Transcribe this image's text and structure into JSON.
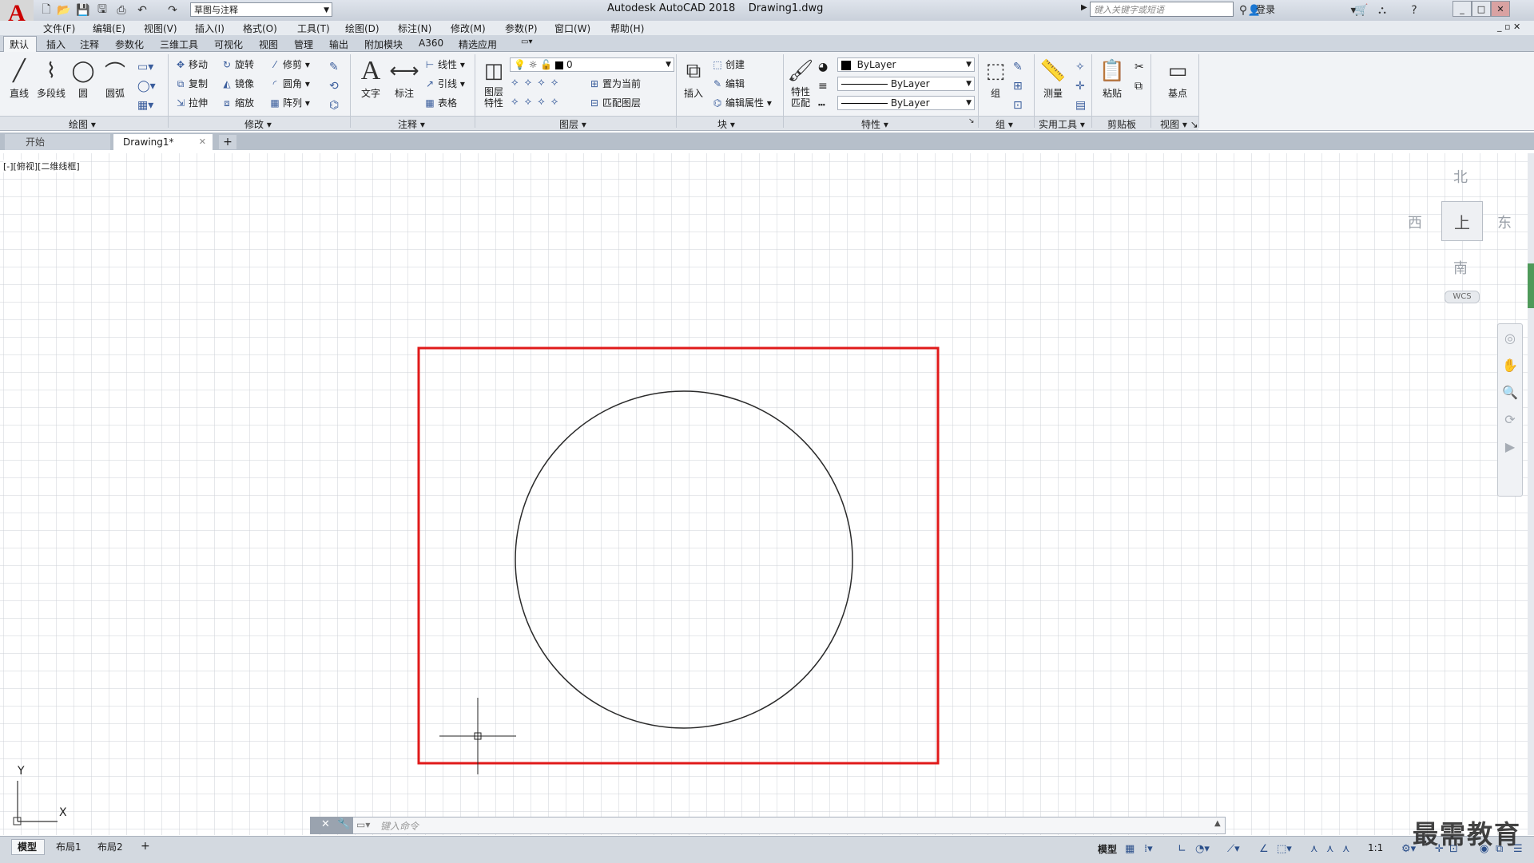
{
  "app": {
    "title": "Autodesk AutoCAD 2018",
    "file": "Drawing1.dwg"
  },
  "quick_access": {
    "workspace": "草图与注释"
  },
  "search": {
    "placeholder": "键入关键字或短语"
  },
  "user": {
    "login": "登录"
  },
  "menus": [
    "文件(F)",
    "编辑(E)",
    "视图(V)",
    "插入(I)",
    "格式(O)",
    "工具(T)",
    "绘图(D)",
    "标注(N)",
    "修改(M)",
    "参数(P)",
    "窗口(W)",
    "帮助(H)"
  ],
  "ribbon_tabs": [
    "默认",
    "插入",
    "注释",
    "参数化",
    "三维工具",
    "可视化",
    "视图",
    "管理",
    "输出",
    "附加模块",
    "A360",
    "精选应用"
  ],
  "ribbon": {
    "draw": {
      "title": "绘图",
      "line": "直线",
      "polyline": "多段线",
      "circle": "圆",
      "arc": "圆弧"
    },
    "modify": {
      "title": "修改",
      "move": "移动",
      "rotate": "旋转",
      "trim": "修剪",
      "copy": "复制",
      "mirror": "镜像",
      "fillet": "圆角",
      "stretch": "拉伸",
      "scale": "缩放",
      "array": "阵列"
    },
    "annotation": {
      "title": "注释",
      "text": "文字",
      "dimension": "标注",
      "linear": "线性",
      "leader": "引线",
      "table": "表格"
    },
    "layers": {
      "title": "图层",
      "properties_line1": "图层",
      "properties_line2": "特性",
      "current_layer": "0",
      "make_current": "置为当前",
      "match_layer": "匹配图层"
    },
    "block": {
      "title": "块",
      "insert": "插入",
      "create": "创建",
      "edit": "编辑",
      "edit_attributes": "编辑属性"
    },
    "properties": {
      "title": "特性",
      "match_line1": "特性",
      "match_line2": "匹配",
      "color": "ByLayer",
      "linetype": "ByLayer",
      "lineweight": "ByLayer"
    },
    "groups": {
      "title": "组",
      "group": "组"
    },
    "utilities": {
      "title": "实用工具",
      "measure": "测量"
    },
    "clipboard": {
      "title": "剪贴板",
      "paste": "粘贴"
    },
    "view": {
      "title": "视图",
      "base": "基点"
    }
  },
  "doc_tabs": {
    "start": "开始",
    "drawing": "Drawing1*"
  },
  "viewport": {
    "label": "[-][俯视][二维线框]"
  },
  "viewcube": {
    "north": "北",
    "south": "南",
    "east": "东",
    "west": "西",
    "top": "上",
    "wcs": "WCS"
  },
  "ucs": {
    "x": "X",
    "y": "Y"
  },
  "command": {
    "placeholder": "键入命令"
  },
  "layouts": [
    "模型",
    "布局1",
    "布局2"
  ],
  "status": {
    "model": "模型",
    "scale": "1:1"
  },
  "watermark": "最需教育",
  "colors": {
    "highlight_rect": "#e01a1a",
    "grid": "#c8ccd2",
    "circle": "#2a2a2a"
  }
}
